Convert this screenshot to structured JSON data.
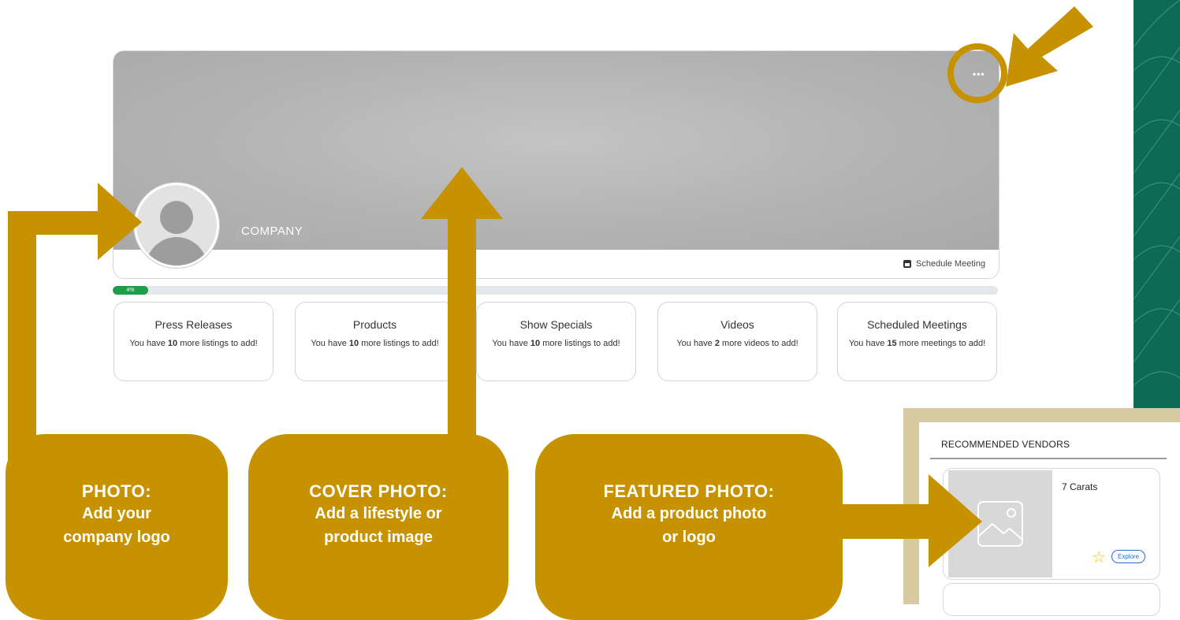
{
  "profile": {
    "menu_label": "•••",
    "company_name": "COMPANY",
    "schedule_label": "Schedule Meeting",
    "progress_percent": 4,
    "progress_label": "4%"
  },
  "stats": [
    {
      "title": "Press Releases",
      "prefix": "You have ",
      "count": "10",
      "suffix": " more listings to add!"
    },
    {
      "title": "Products",
      "prefix": "You have ",
      "count": "10",
      "suffix": " more listings to add!"
    },
    {
      "title": "Show Specials",
      "prefix": "You have ",
      "count": "10",
      "suffix": " more listings to add!"
    },
    {
      "title": "Videos",
      "prefix": "You have ",
      "count": "2",
      "suffix": " more videos to add!"
    },
    {
      "title": "Scheduled Meetings",
      "prefix": "You have ",
      "count": "15",
      "suffix": " more meetings to add!"
    }
  ],
  "callouts": [
    {
      "heading": "PHOTO:",
      "line1": "Add your",
      "line2": "company logo"
    },
    {
      "heading": "COVER PHOTO:",
      "line1": "Add a lifestyle or",
      "line2": "product image"
    },
    {
      "heading": "FEATURED PHOTO:",
      "line1": "Add a product photo",
      "line2": "or logo"
    }
  ],
  "vendors": {
    "title": "RECOMMENDED VENDORS",
    "items": [
      {
        "name": "7 Carats",
        "explore_label": "Explore"
      }
    ]
  },
  "colors": {
    "gold": "#c79200",
    "green_strip": "#0c6a55",
    "progress": "#1f9e4a"
  }
}
